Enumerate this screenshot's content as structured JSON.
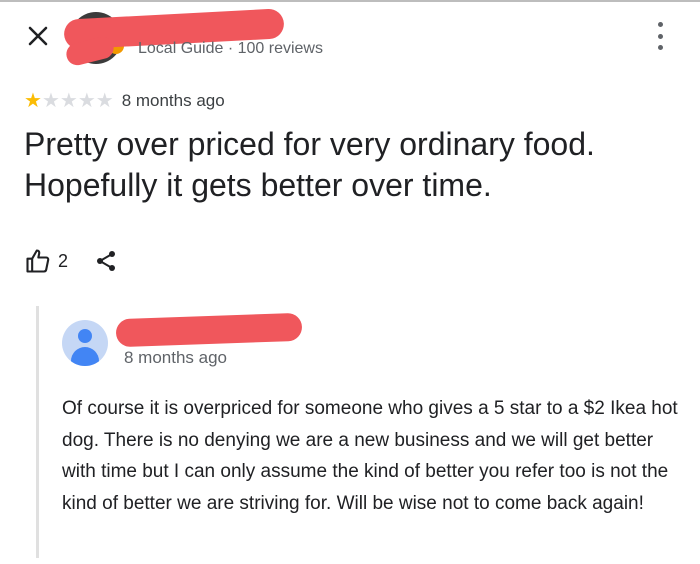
{
  "review": {
    "close_icon": "close-icon",
    "reviewer_meta": "Local Guide · 100 reviews",
    "more_icon": "more-vert-icon",
    "rating": 1,
    "rating_max": 5,
    "time": "8 months ago",
    "text": "Pretty over priced for very ordinary food. Hopefully it gets better over time.",
    "like_count": "2",
    "like_icon": "thumb-up-icon",
    "share_icon": "share-icon"
  },
  "owner_reply": {
    "time": "8 months ago",
    "text": "Of course it is overpriced for someone who gives a 5 star to a $2 Ikea hot dog.  There is no denying we are a new business and we will get better with time but I can only assume the kind of better you refer too is not the kind of better we are striving for. Will be wise not to come back again!"
  },
  "colors": {
    "star_filled": "#fbbc04",
    "star_empty": "#dadce0",
    "redaction": "#f0575c",
    "avatar_placeholder": "#c5d7f5",
    "avatar_person": "#4285f4"
  }
}
